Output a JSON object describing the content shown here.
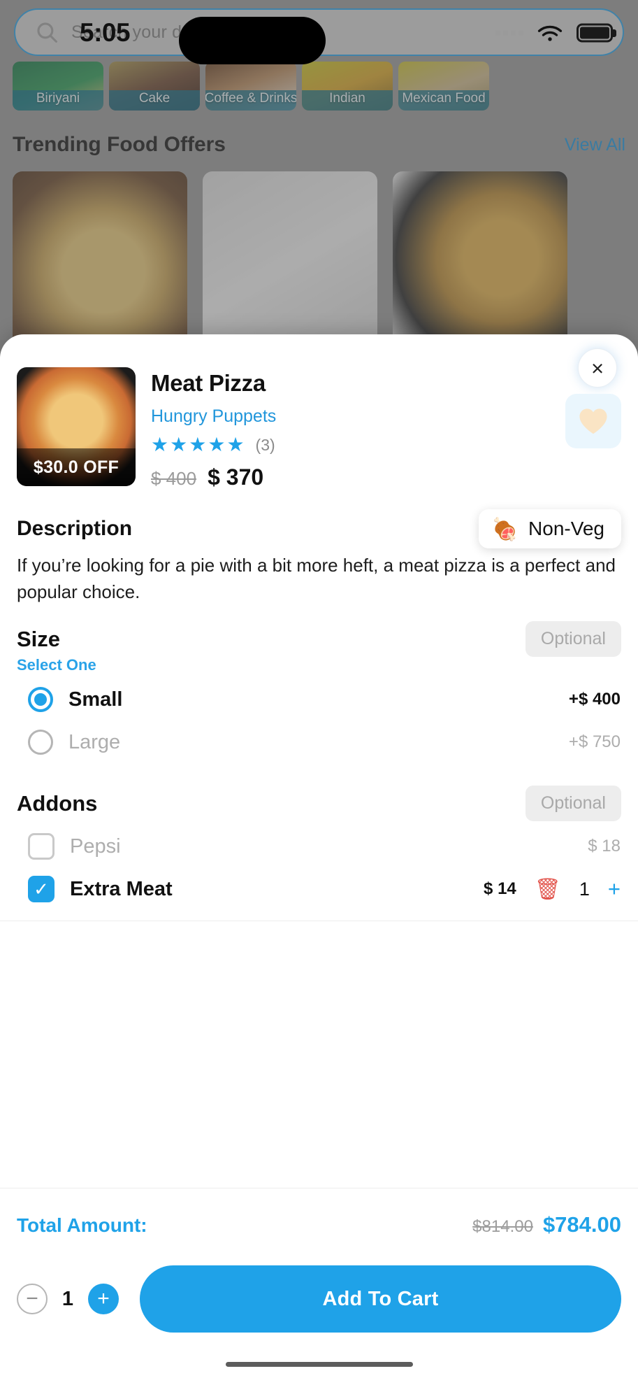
{
  "status_bar": {
    "time": "5:05",
    "wifi_icon": "wifi-icon",
    "battery_icon": "battery-icon"
  },
  "background_app": {
    "search": {
      "placeholder": "Search your desired foods",
      "icon": "search-icon"
    },
    "categories": [
      {
        "label": "Biriyani"
      },
      {
        "label": "Cake"
      },
      {
        "label": "Coffee & Drinks"
      },
      {
        "label": "Indian"
      },
      {
        "label": "Mexican Food"
      }
    ],
    "trending": {
      "title": "Trending Food Offers",
      "view_all": "View All"
    }
  },
  "modal": {
    "close_label": "×",
    "product": {
      "name": "Meat Pizza",
      "restaurant": "Hungry Puppets",
      "discount_badge": "$30.0 OFF",
      "rating_value": 5,
      "rating_count": "(3)",
      "price_old": "$ 400",
      "price_new": "$ 370",
      "favorite_icon": "heart-icon"
    },
    "description": {
      "title": "Description",
      "diet_badge": {
        "label": "Non-Veg",
        "icon": "meat-icon"
      },
      "text": "If you’re looking for a pie with a bit more heft, a meat pizza is a perfect and popular choice."
    },
    "size": {
      "title": "Size",
      "optional_label": "Optional",
      "hint": "Select One",
      "options": [
        {
          "label": "Small",
          "price": "+$ 400",
          "selected": true
        },
        {
          "label": "Large",
          "price": "+$ 750",
          "selected": false
        }
      ]
    },
    "addons": {
      "title": "Addons",
      "optional_label": "Optional",
      "items": [
        {
          "label": "Pepsi",
          "price": "$ 18",
          "checked": false
        },
        {
          "label": "Extra Meat",
          "price": "$ 14",
          "checked": true,
          "qty": "1",
          "delete_icon": "trash-icon",
          "plus_icon": "plus-icon"
        }
      ]
    },
    "footer": {
      "total_label": "Total Amount:",
      "total_old": "$814.00",
      "total_new": "$784.00",
      "quantity": "1",
      "minus_label": "−",
      "plus_label": "+",
      "add_to_cart": "Add To Cart"
    }
  },
  "colors": {
    "accent": "#1fa2e8",
    "link": "#2196db",
    "danger": "#e2554d"
  }
}
